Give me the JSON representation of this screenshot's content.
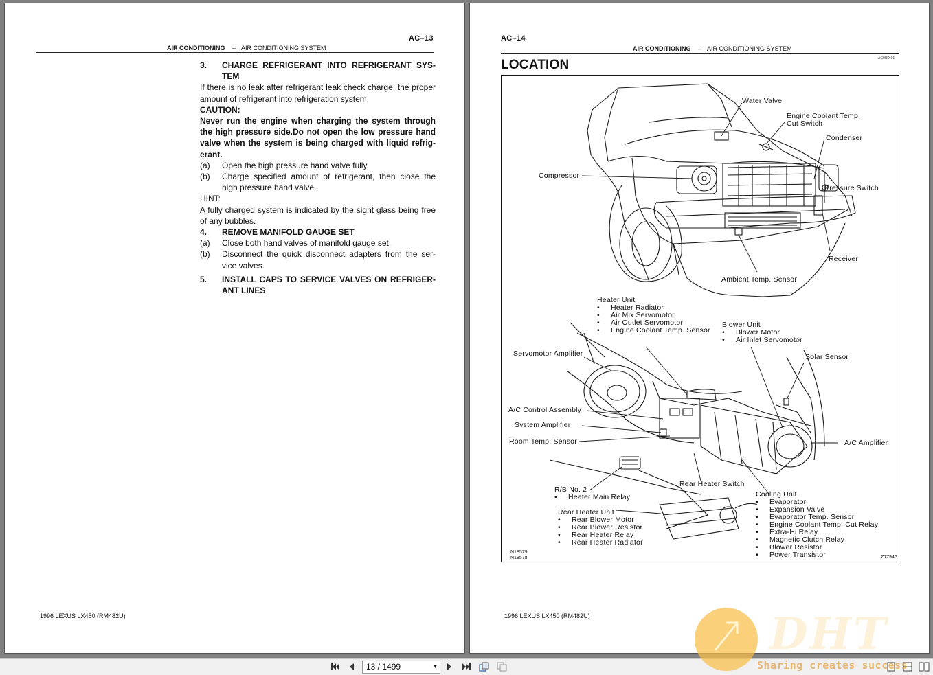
{
  "left_page": {
    "section_code": "AC–13",
    "header_chapter": "AIR CONDITIONING",
    "header_dash": "–",
    "header_section": "AIR CONDITIONING SYSTEM",
    "steps": [
      {
        "num": "3.",
        "title": "CHARGE REFRIGERANT INTO REFRIGERANT SYS-TEM"
      }
    ],
    "step3_text": "If there is no leak after refrigerant leak check charge, the proper amount of refrigerant into refrigeration system.",
    "caution_label": "CAUTION:",
    "caution_text": "Never run the engine when charging the system through the high pressure side.Do not open the low pressure hand valve when the system is being charged with liquid refrig-erant.",
    "step3_sub": [
      {
        "num": "(a)",
        "text": "Open the high pressure hand valve fully."
      },
      {
        "num": "(b)",
        "text": "Charge specified amount of refrigerant, then close the high pressure hand valve."
      }
    ],
    "hint_label": "HINT:",
    "hint_text": "A fully charged system is indicated by the sight glass being free of any bubbles.",
    "step4": {
      "num": "4.",
      "title": "REMOVE MANIFOLD GAUGE SET"
    },
    "step4_sub": [
      {
        "num": "(a)",
        "text": "Close both hand valves of manifold gauge set."
      },
      {
        "num": "(b)",
        "text": "Disconnect the quick disconnect adapters from the ser-vice valves."
      }
    ],
    "step5": {
      "num": "5.",
      "title": "INSTALL CAPS TO SERVICE VALVES ON REFRIGER-ANT LINES"
    },
    "footer": "1996 LEXUS LX450   (RM482U)"
  },
  "right_page": {
    "section_code": "AC–14",
    "header_chapter": "AIR CONDITIONING",
    "header_dash": "–",
    "header_section": "AIR CONDITIONING SYSTEM",
    "title": "LOCATION",
    "tiny_code": "AC0UD-01",
    "labels": {
      "water_valve": "Water Valve",
      "ect_switch_1": "Engine Coolant Temp.",
      "ect_switch_2": "Cut Switch",
      "condenser": "Condenser",
      "compressor": "Compressor",
      "pressure_switch": "Pressure Switch",
      "receiver": "Receiver",
      "ambient_sensor": "Ambient Temp. Sensor",
      "heater_unit": "Heater Unit",
      "blower_unit": "Blower Unit",
      "servomotor_amplifier": "Servomotor Amplifier",
      "solar_sensor": "Solar Sensor",
      "ac_control": "A/C Control Assembly",
      "system_amplifier": "System Amplifier",
      "room_sensor": "Room Temp. Sensor",
      "ac_amplifier": "A/C Amplifier",
      "rb_no2": "R/B No. 2",
      "rear_heater_switch": "Rear Heater Switch",
      "cooling_unit": "Cooling Unit",
      "rear_heater_unit": "Rear Heater Unit",
      "fig_code_1": "N18579",
      "fig_code_2": "N18578",
      "fig_code_3": "Z17946"
    },
    "heater_unit_items": [
      "Heater Radiator",
      "Air Mix Servomotor",
      "Air Outlet Servomotor",
      "Engine Coolant Temp. Sensor"
    ],
    "blower_unit_items": [
      "Blower Motor",
      "Air Inlet Servomotor"
    ],
    "rb_items": [
      "Heater Main Relay"
    ],
    "rear_heater_items": [
      "Rear Blower Motor",
      "Rear Blower Resistor",
      "Rear Heater Relay",
      "Rear Heater Radiator"
    ],
    "cooling_unit_items": [
      "Evaporator",
      "Expansion Valve",
      "Evaporator Temp. Sensor",
      "Engine Coolant Temp. Cut Relay",
      "Extra-Hi Relay",
      "Magnetic Clutch Relay",
      "Blower Resistor",
      "Power Transistor"
    ],
    "footer": "1996 LEXUS LX450   (RM482U)"
  },
  "toolbar": {
    "page_indicator": "13 / 1499",
    "icons": [
      "first-page-icon",
      "prev-page-icon",
      "next-page-icon",
      "last-page-icon",
      "rotate-icon",
      "fit-icon",
      "single-page-icon",
      "two-page-icon",
      "book-view-icon"
    ]
  },
  "watermark": {
    "logo": "DHT",
    "slogan": "Sharing creates success"
  }
}
